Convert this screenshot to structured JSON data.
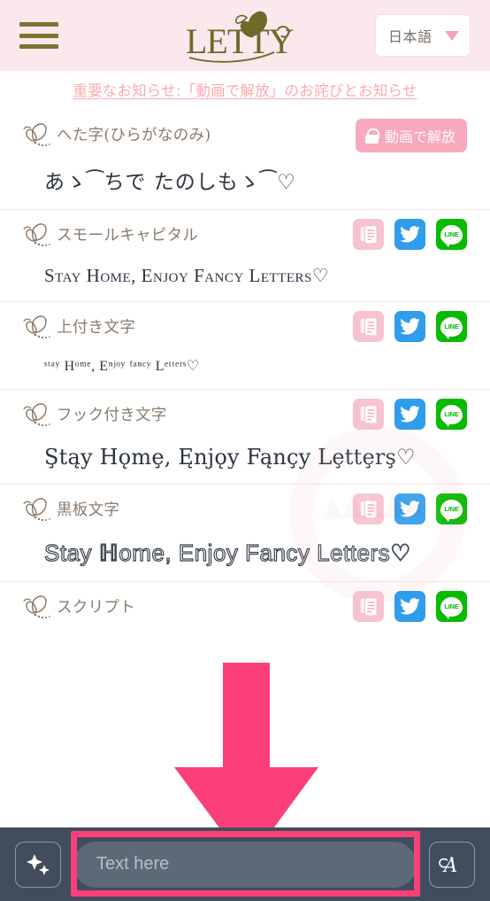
{
  "header": {
    "menu_icon": "hamburger-menu-icon",
    "logo_text": "LETTY",
    "logo_icon": "butterfly-icon",
    "language": {
      "selected": "日本語",
      "caret_icon": "chevron-down-icon"
    }
  },
  "notice": {
    "text": "重要なお知らせ:「動画で解放」のお詫びとお知らせ"
  },
  "actions": {
    "copy_label": "copy-icon",
    "twitter_label": "twitter-icon",
    "line_label": "LINE",
    "unlock_label": "動画で解放",
    "lock_icon": "lock-icon"
  },
  "rows": [
    {
      "label": "へた字(ひらがなのみ)",
      "sample": "あゝ⁀ちで たのしもゝ⁀♡",
      "locked": true,
      "style": "s-heta"
    },
    {
      "label": "スモールキャピタル",
      "sample": "Stay Home, Enjoy Fancy Letters♡",
      "locked": false,
      "style": "s-small"
    },
    {
      "label": "上付き文字",
      "sample": "ˢᵗᵃʸ Hᵒᵐᵉ, Eⁿʲᵒʸ ᶠᵃⁿᶜʸ Lᵉᵗᵗᵉʳˢ♡",
      "locked": false,
      "style": "s-sup"
    },
    {
      "label": "フック付き文字",
      "sample": "Ştąy Hǫmȩ, Ęnjǫy Fąnçy Lȩttȩrş♡",
      "locked": false,
      "style": "s-hook"
    },
    {
      "label": "黒板文字",
      "sample": "Stay ℍome, Enjoy Fancy Letters♡",
      "locked": false,
      "style": "s-chalk"
    },
    {
      "label": "スクリプト",
      "sample": "",
      "locked": false,
      "style": "s-script"
    }
  ],
  "bottom_bar": {
    "left_button_icon": "sparkles-icon",
    "right_button_icon": "script-font-a-icon",
    "input_placeholder": "Text here",
    "input_value": ""
  },
  "overlay": {
    "arrow_icon": "down-arrow-annotation",
    "arrow_color": "#fb3f79",
    "highlight_color": "#fb3f79"
  },
  "colors": {
    "header_bg": "#fae8ec",
    "logo": "#6e6a2a",
    "notice_link": "#ffaaae",
    "copy_btn": "#f7c3ce",
    "twitter_btn": "#2f9cec",
    "line_btn": "#06bb00",
    "unlock_btn": "#f9a9bd",
    "bottom_bar_bg": "#414d5c",
    "input_bg": "#5e6978"
  }
}
